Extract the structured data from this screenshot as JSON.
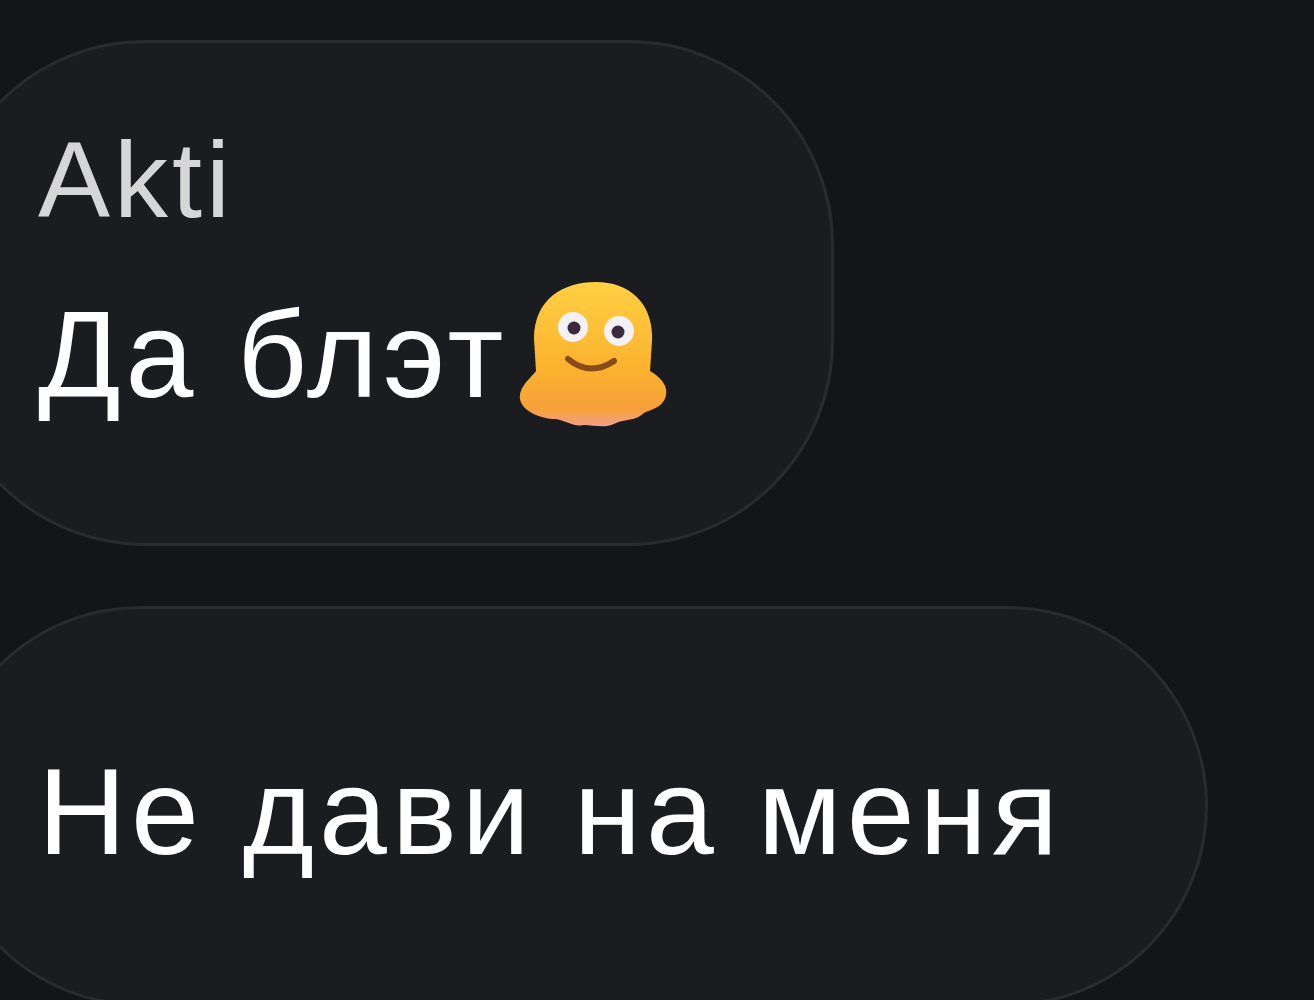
{
  "messages": [
    {
      "sender": "Akti",
      "text": "Да блэт",
      "emoji_after": true
    },
    {
      "text": "Не дави на меня",
      "emoji_after": false
    }
  ]
}
